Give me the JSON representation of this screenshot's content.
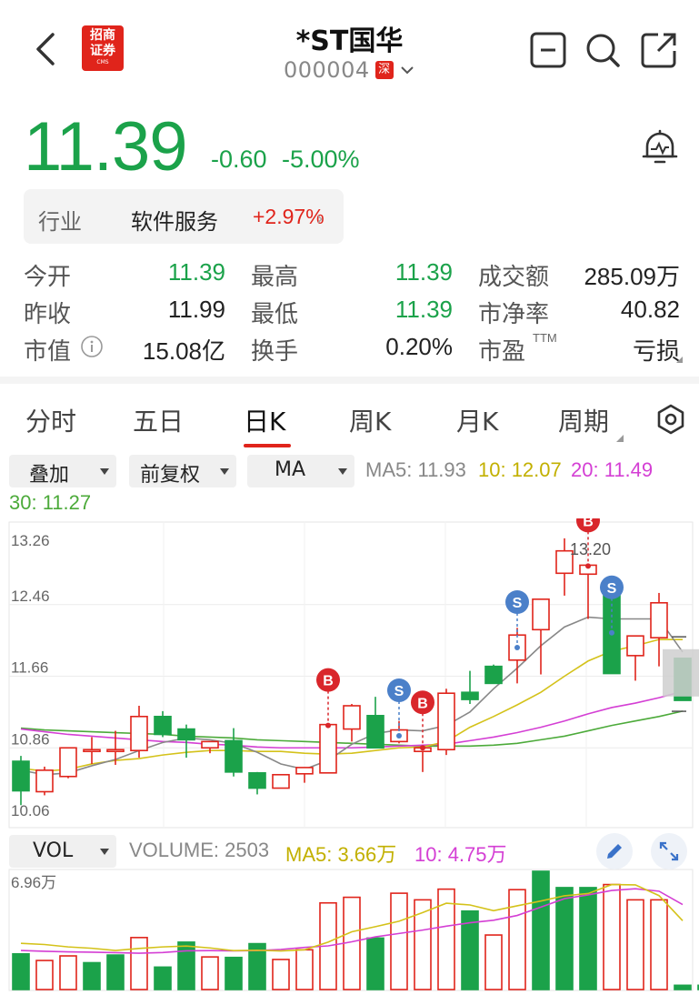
{
  "header": {
    "title": "*ST国华",
    "code": "000004",
    "market_badge": "深",
    "logo_lines": [
      "招商",
      "证券"
    ],
    "logo_small": "CMS"
  },
  "quote": {
    "price": "11.39",
    "change": "-0.60",
    "change_pct": "-5.00%"
  },
  "industry": {
    "label": "行业",
    "name": "软件服务",
    "pct": "+2.97%",
    "arrow": "›"
  },
  "stats": {
    "open_label": "今开",
    "open": "11.39",
    "high_label": "最高",
    "high": "11.39",
    "amount_label": "成交额",
    "amount": "285.09万",
    "prev_label": "昨收",
    "prev": "11.99",
    "low_label": "最低",
    "low": "11.39",
    "pb_label": "市净率",
    "pb": "40.82",
    "mcap_label": "市值",
    "mcap": "15.08亿",
    "turnover_label": "换手",
    "turnover": "0.20%",
    "pe_label": "市盈",
    "pe_sup": "TTM",
    "pe": "亏损"
  },
  "tabs": [
    "分时",
    "五日",
    "日K",
    "周K",
    "月K",
    "周期"
  ],
  "controls": {
    "overlay": "叠加",
    "adjust": "前复权",
    "indicator": "MA",
    "ma5": "MA5: 11.93",
    "ma10": "10: 12.07",
    "ma20": "20: 11.49",
    "ma30": "30: 11.27"
  },
  "colors": {
    "up": "#e0241b",
    "down": "#1ba24a",
    "ma5": "#888888",
    "ma10": "#d4c21a",
    "ma20": "#d43fd4",
    "ma30": "#4caa3a",
    "buy": "#d9262b",
    "sell": "#4b80c9"
  },
  "chart_data": {
    "type": "candlestick",
    "price_axis": {
      "labels": [
        "13.26",
        "12.46",
        "11.66",
        "10.86",
        "10.06"
      ],
      "ylim": [
        10.06,
        13.26
      ]
    },
    "high_annotation": "13.20",
    "candles": [
      {
        "o": 10.71,
        "h": 10.77,
        "l": 10.22,
        "c": 10.38
      },
      {
        "o": 10.37,
        "h": 10.65,
        "l": 10.33,
        "c": 10.61
      },
      {
        "o": 10.54,
        "h": 10.86,
        "l": 10.52,
        "c": 10.86
      },
      {
        "o": 10.84,
        "h": 10.98,
        "l": 10.68,
        "c": 10.84
      },
      {
        "o": 10.84,
        "h": 11.05,
        "l": 10.67,
        "c": 10.84
      },
      {
        "o": 10.83,
        "h": 11.33,
        "l": 10.75,
        "c": 11.21
      },
      {
        "o": 11.21,
        "h": 11.27,
        "l": 10.98,
        "c": 11.01
      },
      {
        "o": 11.07,
        "h": 11.12,
        "l": 10.75,
        "c": 10.95
      },
      {
        "o": 10.86,
        "h": 10.93,
        "l": 10.8,
        "c": 10.93
      },
      {
        "o": 10.94,
        "h": 11.08,
        "l": 10.54,
        "c": 10.59
      },
      {
        "o": 10.58,
        "h": 10.59,
        "l": 10.34,
        "c": 10.41
      },
      {
        "o": 10.41,
        "h": 10.56,
        "l": 10.41,
        "c": 10.56
      },
      {
        "o": 10.57,
        "h": 10.64,
        "l": 10.47,
        "c": 10.64
      },
      {
        "o": 10.58,
        "h": 11.11,
        "l": 10.58,
        "c": 11.12
      },
      {
        "o": 11.07,
        "h": 11.35,
        "l": 10.93,
        "c": 11.33
      },
      {
        "o": 11.22,
        "h": 11.43,
        "l": 10.86,
        "c": 10.86
      },
      {
        "o": 10.93,
        "h": 11.16,
        "l": 10.91,
        "c": 11.06
      },
      {
        "o": 10.82,
        "h": 10.86,
        "l": 10.59,
        "c": 10.86
      },
      {
        "o": 10.84,
        "h": 11.52,
        "l": 10.78,
        "c": 11.47
      },
      {
        "o": 11.48,
        "h": 11.72,
        "l": 11.35,
        "c": 11.4
      },
      {
        "o": 11.77,
        "h": 11.79,
        "l": 11.58,
        "c": 11.58
      },
      {
        "o": 11.84,
        "h": 12.2,
        "l": 11.58,
        "c": 12.12
      },
      {
        "o": 12.18,
        "h": 12.18,
        "l": 11.68,
        "c": 12.52
      },
      {
        "o": 12.81,
        "h": 13.2,
        "l": 12.56,
        "c": 13.06
      },
      {
        "o": 12.8,
        "h": 12.89,
        "l": 12.3,
        "c": 12.9
      },
      {
        "o": 12.6,
        "h": 12.6,
        "l": 11.69,
        "c": 11.69
      },
      {
        "o": 11.89,
        "h": 11.96,
        "l": 11.61,
        "c": 12.11
      },
      {
        "o": 12.09,
        "h": 12.59,
        "l": 11.77,
        "c": 12.48
      },
      {
        "o": 11.86,
        "h": 11.86,
        "l": 11.39,
        "c": 11.39
      }
    ],
    "ma5": [
      10.61,
      10.56,
      10.58,
      10.66,
      10.73,
      10.83,
      10.92,
      10.97,
      10.95,
      10.91,
      10.81,
      10.68,
      10.62,
      10.72,
      10.9,
      11.02,
      11.06,
      11.05,
      11.11,
      11.26,
      11.52,
      11.75,
      12.0,
      12.21,
      12.32,
      12.3,
      12.3,
      12.3,
      11.93
    ],
    "ma10": [
      10.63,
      10.6,
      10.62,
      10.68,
      10.72,
      10.74,
      10.78,
      10.81,
      10.83,
      10.83,
      10.82,
      10.82,
      10.8,
      10.79,
      10.8,
      10.83,
      10.86,
      10.87,
      10.93,
      11.09,
      11.21,
      11.34,
      11.48,
      11.66,
      11.83,
      11.94,
      12.0,
      12.07,
      12.07
    ],
    "ma20": [
      11.07,
      11.04,
      11.01,
      10.99,
      10.97,
      10.95,
      10.93,
      10.92,
      10.9,
      10.89,
      10.87,
      10.86,
      10.86,
      10.86,
      10.86,
      10.87,
      10.88,
      10.89,
      10.9,
      10.94,
      10.98,
      11.03,
      11.09,
      11.16,
      11.24,
      11.31,
      11.36,
      11.42,
      11.49
    ],
    "ma30": [
      11.08,
      11.06,
      11.05,
      11.04,
      11.03,
      11.02,
      11.01,
      10.99,
      10.98,
      10.97,
      10.95,
      10.94,
      10.93,
      10.92,
      10.91,
      10.9,
      10.89,
      10.88,
      10.88,
      10.88,
      10.89,
      10.91,
      10.95,
      10.99,
      11.05,
      11.11,
      11.16,
      11.21,
      11.27
    ],
    "markers": [
      {
        "index": 13,
        "type": "B"
      },
      {
        "index": 16,
        "type": "S"
      },
      {
        "index": 17,
        "type": "B"
      },
      {
        "index": 21,
        "type": "S"
      },
      {
        "index": 24,
        "type": "B"
      },
      {
        "index": 25,
        "type": "S"
      }
    ],
    "volume": {
      "selector": "VOL",
      "volume_label": "VOLUME: 2503",
      "ma5_label": "MA5: 3.66万",
      "ma10_label": "10: 4.75万",
      "axis_label": "6.96万",
      "ymax": 6.96,
      "values": [
        2.1,
        1.71,
        1.98,
        1.58,
        2.03,
        3.06,
        1.32,
        2.79,
        1.92,
        1.89,
        2.7,
        1.77,
        2.34,
        5.1,
        5.43,
        3.03,
        5.67,
        5.28,
        5.91,
        4.62,
        3.21,
        5.88,
        6.96,
        6.0,
        6.0,
        6.18,
        5.28,
        5.28,
        0.25,
        0.25
      ],
      "up": [
        false,
        true,
        true,
        false,
        false,
        true,
        false,
        false,
        true,
        false,
        false,
        true,
        true,
        true,
        true,
        false,
        true,
        true,
        true,
        false,
        true,
        true,
        false,
        false,
        false,
        true,
        true,
        true,
        false,
        false
      ],
      "ma5": [
        2.72,
        2.65,
        2.51,
        2.43,
        2.3,
        2.42,
        2.51,
        2.56,
        2.45,
        2.29,
        2.31,
        2.27,
        2.34,
        2.79,
        3.4,
        3.7,
        4.02,
        4.53,
        5.08,
        4.98,
        4.64,
        4.93,
        5.21,
        5.52,
        5.65,
        6.18,
        6.16,
        5.53,
        4.05
      ],
      "ma10": [
        2.3,
        2.25,
        2.22,
        2.2,
        2.17,
        2.14,
        2.18,
        2.28,
        2.29,
        2.28,
        2.29,
        2.36,
        2.48,
        2.57,
        2.81,
        3.1,
        3.3,
        3.5,
        3.73,
        3.93,
        4.08,
        4.36,
        4.85,
        5.35,
        5.57,
        5.83,
        5.93,
        5.79,
        5.0
      ]
    }
  }
}
